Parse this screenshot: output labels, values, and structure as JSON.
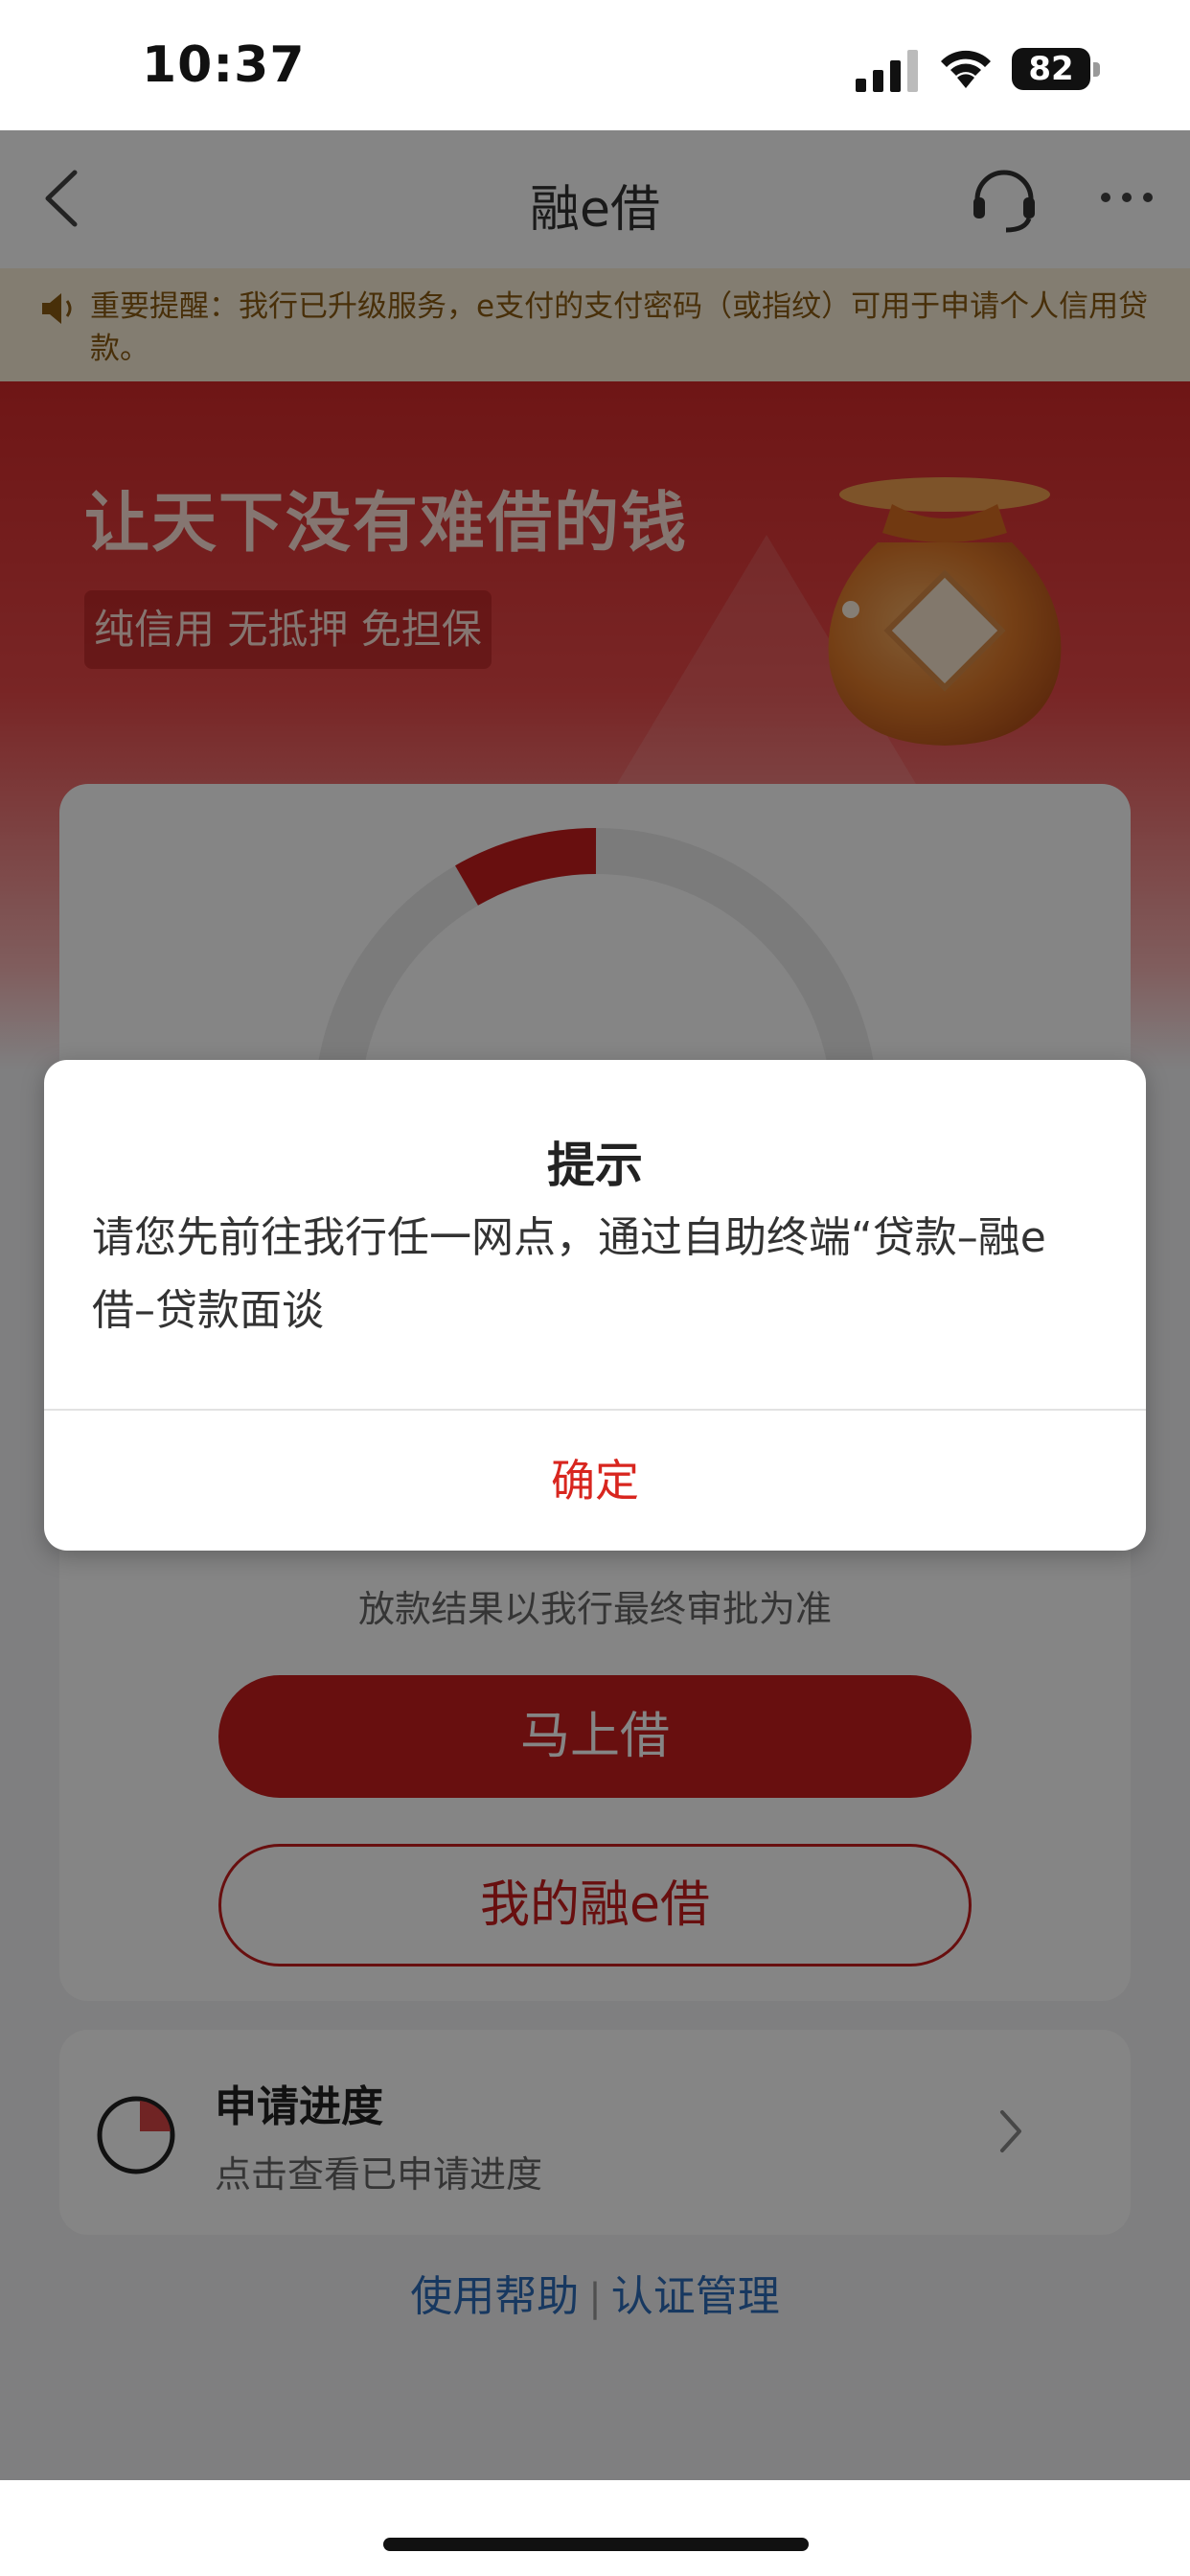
{
  "status_bar": {
    "time": "10:37",
    "battery": "82",
    "icons": [
      "cellular-signal-icon",
      "wifi-icon",
      "battery-icon"
    ]
  },
  "nav": {
    "title": "融e借",
    "icons": [
      "back-arrow-icon",
      "headset-icon",
      "more-icon"
    ]
  },
  "notice": {
    "text": "重要提醒：我行已升级服务，e支付的支付密码（或指纹）可用于申请个人信用贷款。",
    "icon": "speaker-icon"
  },
  "hero": {
    "title": "让天下没有难借的钱",
    "tags": "纯信用 无抵押 免担保"
  },
  "main": {
    "disclaimer": "放款结果以我行最终审批为准",
    "borrow_button": "马上借",
    "my_loan_button": "我的融e借"
  },
  "progress": {
    "title": "申请进度",
    "subtitle": "点击查看已申请进度"
  },
  "footer": {
    "help": "使用帮助",
    "separator": "|",
    "auth": "认证管理"
  },
  "dialog": {
    "title": "提示",
    "message": "请您先前往我行任一网点，通过自助终端“贷款–融e借–贷款面谈",
    "confirm": "确定"
  },
  "colors": {
    "accent_red": "#c81e1e",
    "confirm_red": "#d8261f",
    "link_blue": "#2d6bb8",
    "notice_bg": "#fbf0d8"
  }
}
